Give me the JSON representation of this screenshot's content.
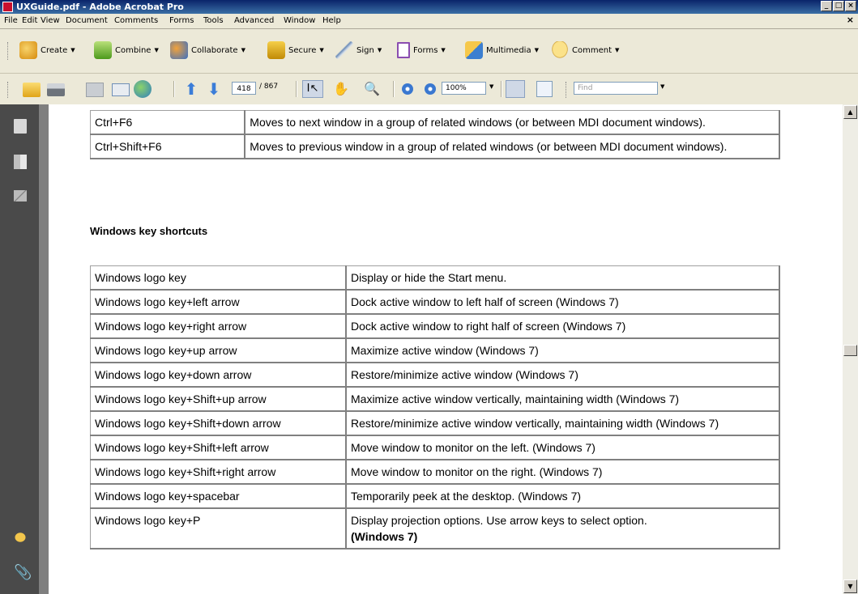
{
  "window": {
    "title": "UXGuide.pdf - Adobe Acrobat Pro"
  },
  "menu": [
    "File",
    "Edit",
    "View",
    "Document",
    "Comments",
    "Forms",
    "Tools",
    "Advanced",
    "Window",
    "Help"
  ],
  "tasks": {
    "create": "Create",
    "combine": "Combine",
    "collaborate": "Collaborate",
    "secure": "Secure",
    "sign": "Sign",
    "forms": "Forms",
    "multimedia": "Multimedia",
    "comment": "Comment"
  },
  "nav": {
    "page": "418",
    "page_count": "/ 867",
    "zoom": "100%",
    "find_placeholder": "Find"
  },
  "doc": {
    "top_rows": [
      {
        "key": "Ctrl+F6",
        "desc": "Moves to next window in a group of related windows (or between MDI document windows)."
      },
      {
        "key": "Ctrl+Shift+F6",
        "desc": "Moves to previous window in a group of related windows (or between MDI document windows)."
      }
    ],
    "heading": "Windows key shortcuts",
    "win_rows": [
      {
        "key": "Windows logo key",
        "desc": "Display or hide the Start menu."
      },
      {
        "key": "Windows logo key+left arrow",
        "desc": "Dock active window to left half of screen (Windows 7)"
      },
      {
        "key": "Windows logo key+right arrow",
        "desc": "Dock active window to right half of screen (Windows 7)"
      },
      {
        "key": "Windows logo key+up arrow",
        "desc": "Maximize active window (Windows 7)"
      },
      {
        "key": "Windows logo key+down arrow",
        "desc": "Restore/minimize active window (Windows 7)"
      },
      {
        "key": "Windows logo key+Shift+up arrow",
        "desc": "Maximize active window vertically, maintaining width (Windows 7)"
      },
      {
        "key": "Windows logo key+Shift+down arrow",
        "desc": "Restore/minimize active window vertically, maintaining width (Windows 7)"
      },
      {
        "key": "Windows logo key+Shift+left arrow",
        "desc": "Move window to monitor on the left. (Windows 7)"
      },
      {
        "key": "Windows logo key+Shift+right arrow",
        "desc": "Move window to monitor on the right. (Windows 7)"
      },
      {
        "key": "Windows logo key+spacebar",
        "desc": "Temporarily peek at the desktop. (Windows 7)"
      },
      {
        "key": "Windows logo key+P",
        "desc": "Display projection options. Use arrow keys to select option.",
        "desc_bold": "(Windows 7)"
      }
    ]
  },
  "colors": {
    "titlebar": "#0a246a",
    "panel": "#4a4a4a",
    "docbg": "#7f7f7f"
  }
}
